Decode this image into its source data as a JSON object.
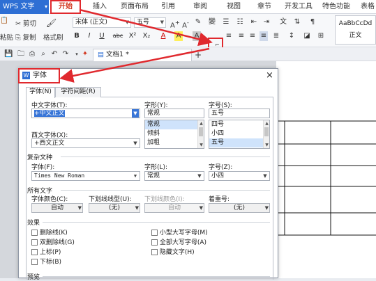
{
  "app": {
    "name": "WPS 文字",
    "menu_caret": "▾"
  },
  "menu": [
    "开始",
    "插入",
    "页面布局",
    "引用",
    "审阅",
    "视图",
    "章节",
    "开发工具",
    "特色功能",
    "表格"
  ],
  "ribbon": {
    "paste": "粘贴",
    "cut": "剪切",
    "copy": "复制",
    "format_painter": "格式刷",
    "font_name": "宋体 (正文)",
    "font_size": "五号",
    "bold": "B",
    "italic": "I",
    "underline": "U",
    "strike": "abc",
    "superscript": "X²",
    "subscript": "X₂",
    "font_color_a": "A",
    "highlight": "A",
    "char_border": "A",
    "dialog_launcher": "⌐",
    "style_preview": "AaBbCcDd",
    "style_name": "正文"
  },
  "doc_tab": {
    "label": "文档1 *",
    "add": "+"
  },
  "dialog": {
    "title": "字体",
    "close": "×",
    "tabs": [
      "字体(N)",
      "字符间距(R)"
    ],
    "chinese_font_label": "中文字体(T):",
    "chinese_font_value": "+中文正文",
    "western_font_label": "西文字体(X):",
    "western_font_value": "+西文正文",
    "style_label": "字形(Y):",
    "style_value": "常规",
    "style_options": [
      "常规",
      "倾斜",
      "加粗"
    ],
    "size_label": "字号(S):",
    "size_value": "五号",
    "size_options": [
      "四号",
      "小四",
      "五号"
    ],
    "complex_section": "复杂文种",
    "complex_font_label": "字体(F):",
    "complex_font_value": "Times New Roman",
    "complex_style_label": "字形(L):",
    "complex_style_value": "常规",
    "complex_size_label": "字号(Z):",
    "complex_size_value": "小四",
    "all_text_section": "所有文字",
    "font_color_label": "字体颜色(C):",
    "font_color_value": "自动",
    "underline_type_label": "下划线线型(U):",
    "underline_type_value": "(无)",
    "underline_color_label": "下划线颜色(I):",
    "underline_color_value": "自动",
    "emphasis_label": "着重号:",
    "emphasis_value": "(无)",
    "effects_section": "效果",
    "effects_left": [
      "删除线(K)",
      "双删除线(G)",
      "上标(P)",
      "下标(B)"
    ],
    "effects_right": [
      "小型大写字母(M)",
      "全部大写字母(A)",
      "隐藏文字(H)"
    ],
    "preview_section": "预览"
  },
  "colors": {
    "accent": "#2e6fd4",
    "highlight_red": "#e0292e",
    "active_menu": "#d2371f"
  }
}
